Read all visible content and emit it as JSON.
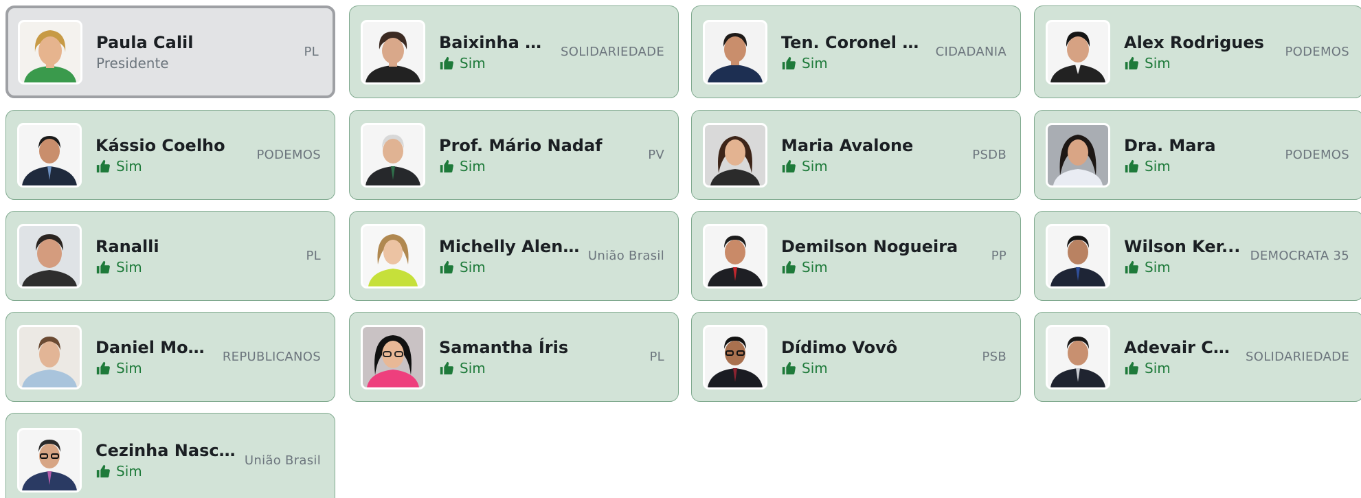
{
  "colors": {
    "card_bg": "#d2e3d7",
    "card_border": "#7fa98e",
    "president_bg": "#e2e3e5",
    "president_border": "#9ea0a4",
    "vote_green": "#1e7a3a",
    "party_gray": "#6c757d"
  },
  "icons": {
    "vote": "thumbs-up-icon",
    "photo": "person-photo"
  },
  "president": {
    "name": "Paula Calil",
    "role": "Presidente",
    "party": "PL"
  },
  "members": [
    {
      "name": "Baixinha Gi...",
      "vote": "Sim",
      "party": "SOLIDARIEDADE"
    },
    {
      "name": "Ten. Coronel D...",
      "vote": "Sim",
      "party": "CIDADANIA"
    },
    {
      "name": "Alex Rodrigues",
      "vote": "Sim",
      "party": "PODEMOS"
    },
    {
      "name": "Kássio Coelho",
      "vote": "Sim",
      "party": "PODEMOS"
    },
    {
      "name": "Prof. Mário Nadaf",
      "vote": "Sim",
      "party": "PV"
    },
    {
      "name": "Maria Avalone",
      "vote": "Sim",
      "party": "PSDB"
    },
    {
      "name": "Dra. Mara",
      "vote": "Sim",
      "party": "PODEMOS"
    },
    {
      "name": "Ranalli",
      "vote": "Sim",
      "party": "PL"
    },
    {
      "name": "Michelly Alencar",
      "vote": "Sim",
      "party": "União Brasil"
    },
    {
      "name": "Demilson Nogueira",
      "vote": "Sim",
      "party": "PP"
    },
    {
      "name": "Wilson Ker...",
      "vote": "Sim",
      "party": "DEMOCRATA 35"
    },
    {
      "name": "Daniel Mon...",
      "vote": "Sim",
      "party": "REPUBLICANOS"
    },
    {
      "name": "Samantha Íris",
      "vote": "Sim",
      "party": "PL"
    },
    {
      "name": "Dídimo Vovô",
      "vote": "Sim",
      "party": "PSB"
    },
    {
      "name": "Adevair Ca...",
      "vote": "Sim",
      "party": "SOLIDARIEDADE"
    },
    {
      "name": "Cezinha Nasci...",
      "vote": "Sim",
      "party": "União Brasil"
    }
  ]
}
